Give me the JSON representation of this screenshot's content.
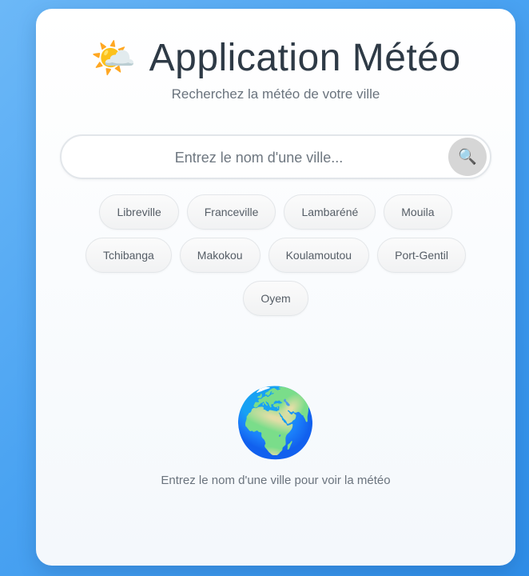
{
  "app": {
    "header_icon": "sun-behind-cloud-icon",
    "header_emoji": "🌤️",
    "title": "Application Météo",
    "subtitle": "Recherchez la météo de votre ville"
  },
  "search": {
    "placeholder": "Entrez le nom d'une ville...",
    "value": "",
    "button_icon": "search-icon",
    "button_emoji": "🔍"
  },
  "cities": [
    "Libreville",
    "Franceville",
    "Lambaréné",
    "Mouila",
    "Tchibanga",
    "Makokou",
    "Koulamoutou",
    "Port-Gentil",
    "Oyem"
  ],
  "empty_state": {
    "icon": "globe-icon",
    "emoji": "🌍",
    "message": "Entrez le nom d'une ville pour voir la météo"
  },
  "colors": {
    "background": "#4aa3f2",
    "card": "#ffffff",
    "title": "#2e3a46",
    "muted_text": "#6a737d",
    "search_button": "#d6d6d6"
  }
}
